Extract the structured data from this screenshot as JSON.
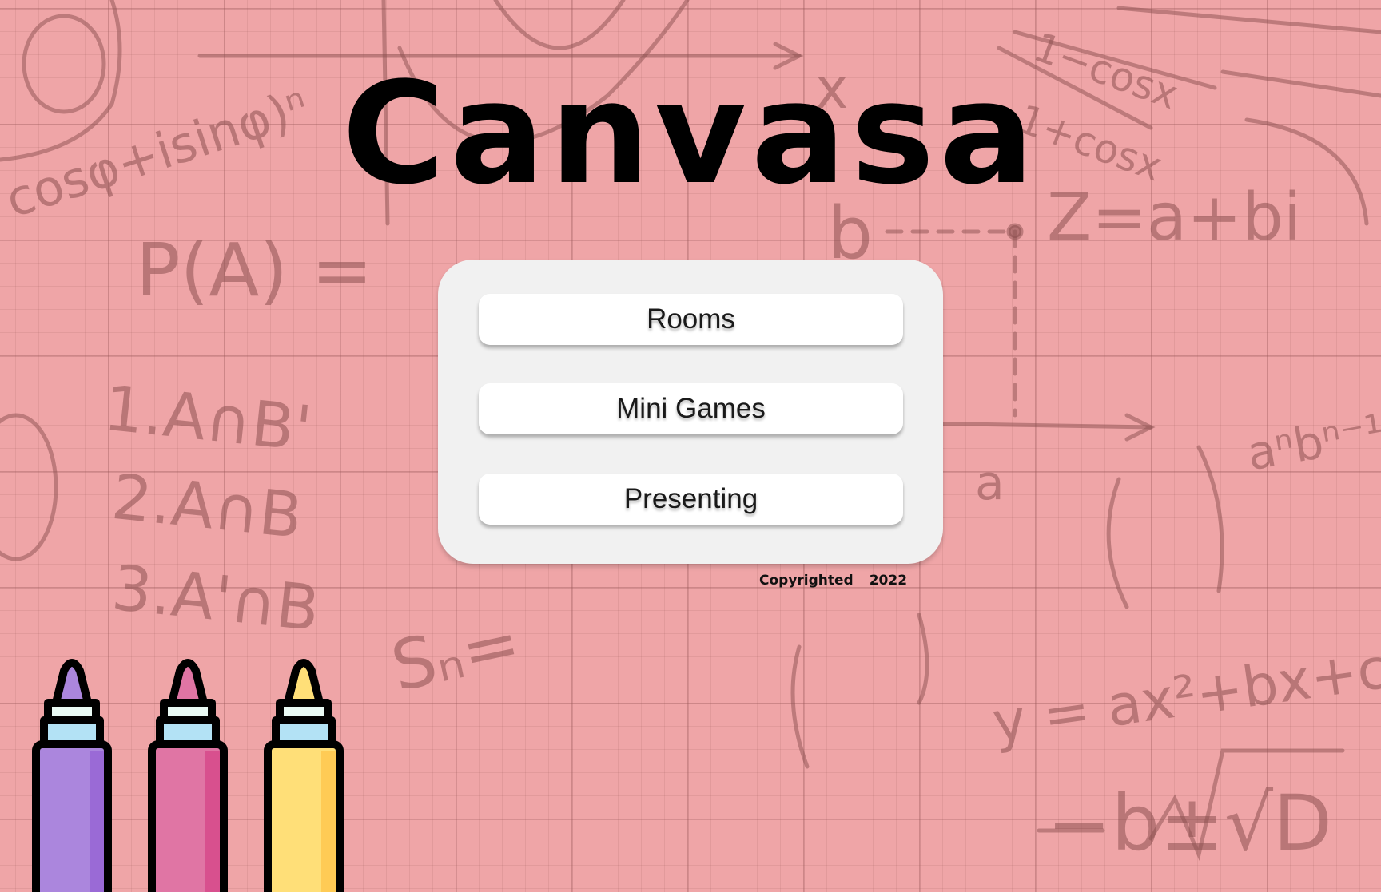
{
  "app": {
    "title": "Canvasa"
  },
  "menu": {
    "items": [
      {
        "label": "Rooms"
      },
      {
        "label": "Mini Games"
      },
      {
        "label": "Presenting"
      }
    ]
  },
  "footer": {
    "copyright_label": "Copyrighted",
    "year": "2022"
  },
  "background": {
    "description_icon": "math-doodle-grid-paper",
    "doodles": [
      "cosφ+isinφ)ⁿ",
      "P(A) =",
      "1.A∩B'",
      "2.A∩B",
      "3.A'∩B",
      "Sₙ=",
      "1−cosx",
      "1+cosx",
      "Z=a+bi",
      "y = ax²+bx+c",
      "−b±√D",
      "a",
      "b",
      "x",
      "aⁿbⁿ⁻¹"
    ]
  },
  "colors": {
    "background": "#efa5a7",
    "panel": "#f1f1f1",
    "button": "#ffffff",
    "marker_purple": "#ab86dd",
    "marker_pink": "#e075a4",
    "marker_yellow": "#ffdf78",
    "marker_cap": "#b3e2f5"
  },
  "icons": {
    "markers": [
      "purple-marker-icon",
      "pink-marker-icon",
      "yellow-marker-icon"
    ]
  }
}
